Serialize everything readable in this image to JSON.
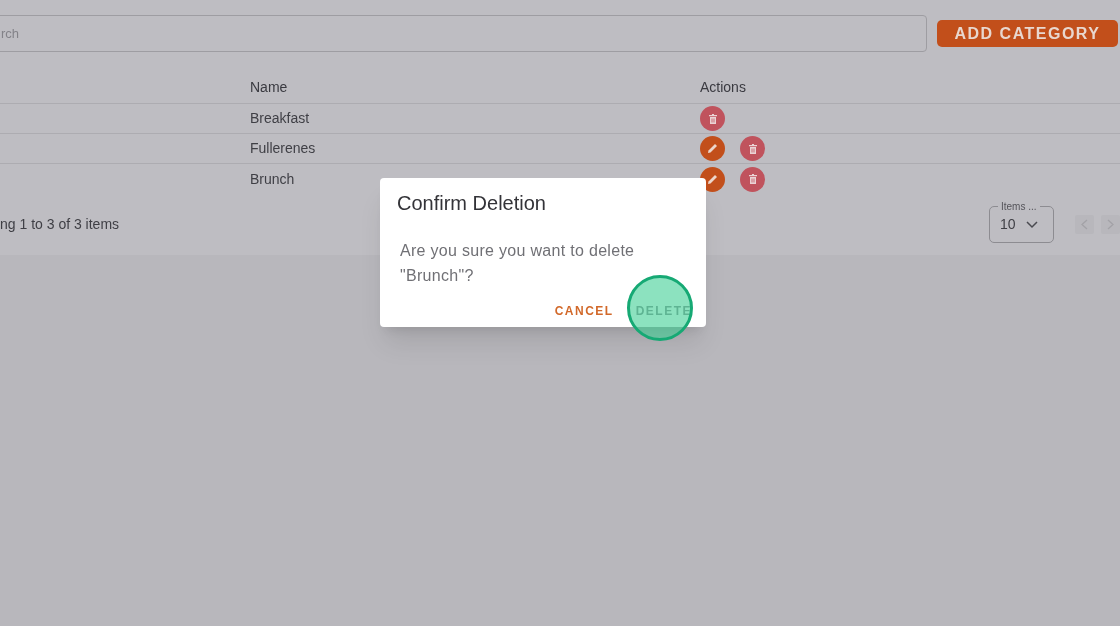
{
  "search": {
    "placeholder": "rch"
  },
  "add_button": "ADD CATEGORY",
  "table": {
    "columns": [
      "Name",
      "Actions"
    ],
    "rows": [
      {
        "name": "Breakfast",
        "actions": [
          {
            "kind": "delete"
          }
        ]
      },
      {
        "name": "Fullerenes",
        "actions": [
          {
            "kind": "edit"
          },
          {
            "kind": "delete"
          }
        ]
      },
      {
        "name": "Brunch",
        "actions": [
          {
            "kind": "edit"
          },
          {
            "kind": "delete"
          }
        ]
      }
    ]
  },
  "footer": {
    "summary": "ng 1 to 3 of 3 items",
    "page_size_label": "Items ...",
    "page_size": "10"
  },
  "dialog": {
    "title": "Confirm Deletion",
    "message": "Are you sure you want to delete \"Brunch\"?",
    "buttons": [
      {
        "label": "CANCEL",
        "kind": "cancel"
      },
      {
        "label": "DELETE",
        "kind": "confirm"
      }
    ]
  }
}
